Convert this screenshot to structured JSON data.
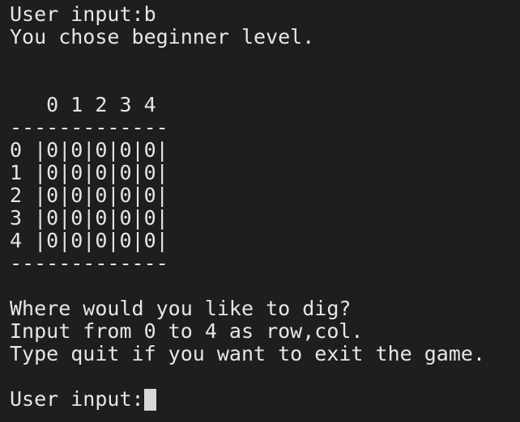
{
  "terminal": {
    "lines": [
      "User input:b",
      "You chose beginner level.",
      "",
      "",
      "   0 1 2 3 4",
      "-------------",
      "0 |0|0|0|0|0|",
      "1 |0|0|0|0|0|",
      "2 |0|0|0|0|0|",
      "3 |0|0|0|0|0|",
      "4 |0|0|0|0|0|",
      "-------------",
      "",
      "Where would you like to dig?",
      "Input from 0 to 4 as row,col.",
      "Type quit if you want to exit the game.",
      ""
    ],
    "prompt": "User input:"
  }
}
